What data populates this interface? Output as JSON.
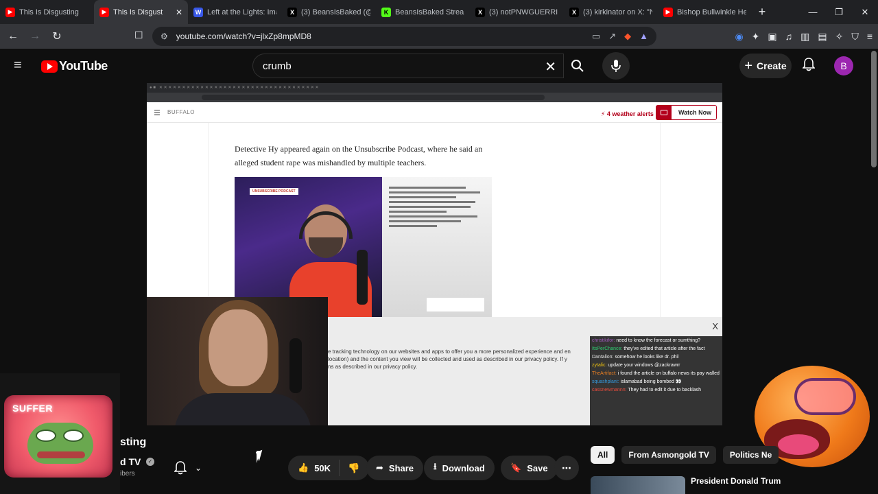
{
  "browser": {
    "tabs": [
      {
        "title": "This Is Disgusting",
        "favicon": "youtube",
        "color": "#ff0000",
        "muted": true
      },
      {
        "title": "This Is Disgust",
        "favicon": "youtube",
        "color": "#ff0000",
        "active": true
      },
      {
        "title": "Left at the Lights: Ima",
        "favicon": "wordpress",
        "color": "#3858e9"
      },
      {
        "title": "(3) BeansIsBaked (@B",
        "favicon": "x",
        "color": "#000000"
      },
      {
        "title": "BeansIsBaked Stream",
        "favicon": "kick",
        "color": "#53fc18"
      },
      {
        "title": "(3) notPNWGUERRILL",
        "favicon": "x",
        "color": "#000000"
      },
      {
        "title": "(3) kirkinator on X: \"N",
        "favicon": "x",
        "color": "#000000"
      },
      {
        "title": "Bishop Bullwinkle Hel",
        "favicon": "youtube",
        "color": "#ff0000"
      }
    ],
    "url": "youtube.com/watch?v=jlxZp8mpMD8"
  },
  "youtube": {
    "logo_text": "YouTube",
    "search_value": "crumb",
    "create_label": "Create",
    "avatar_letter": "B"
  },
  "video": {
    "news_logo": "BUFFALO",
    "alerts": "4 weather alerts",
    "watch_now": "Watch Now",
    "article_text": "Detective Hy appeared again on the Unsubscribe Podcast, where he said an alleged student rape was mishandled by multiple teachers.",
    "embed_tag": "UNSUBSCRIBE PODCAST",
    "cookie_text_1": "e tracking technology on our websites and apps to offer you a more personalized experience and en",
    "cookie_text_2": "location) and the content you view will be collected and used as described in our privacy policy. If y",
    "cookie_text_3": "ns as described in our privacy policy.",
    "cookie_close": "X",
    "chat": [
      {
        "user": "christikifor",
        "color": "#9b59b6",
        "text": "need to know the forecast or sumthing?"
      },
      {
        "user": "ItsPerChance",
        "color": "#2ecc71",
        "text": "they've edited that article after the fact"
      },
      {
        "user": "Dantalion",
        "color": "#e0e0e0",
        "text": "somehow he looks like dr. phil"
      },
      {
        "user": "zytalic",
        "color": "#f1c40f",
        "text": "update your windows @zackrawrr"
      },
      {
        "user": "TheArtifact",
        "color": "#e67e22",
        "text": "i found the article on buffalo news its pay walled"
      },
      {
        "user": "squashplant",
        "color": "#3498db",
        "text": "islamabad being bombed 👀"
      },
      {
        "user": "cassnewmannn",
        "color": "#e74c3c",
        "text": "They had to edit it due to backlash"
      }
    ],
    "overlay_text": "SUFFER"
  },
  "meta": {
    "title_fragment": "sting",
    "channel_fragment": "d TV",
    "subs_fragment": "ibers",
    "likes": "50K",
    "share": "Share",
    "download": "Download",
    "save": "Save",
    "chips": [
      "All",
      "From Asmongold TV",
      "Politics Ne"
    ],
    "rec_title": "President Donald Trum"
  }
}
